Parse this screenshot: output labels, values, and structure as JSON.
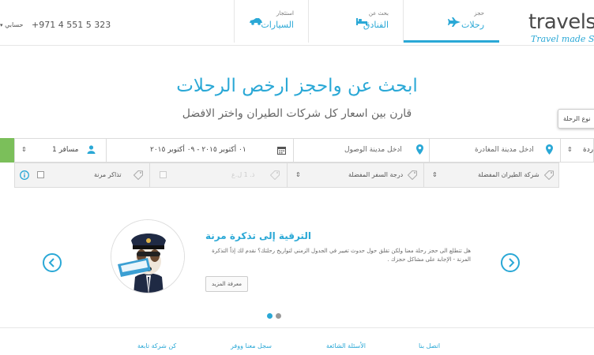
{
  "header": {
    "brand_name": "travelst",
    "brand_tagline": "Travel made S",
    "phone": "+971 4 551 5 323",
    "account_label": "حسابي",
    "tabs": [
      {
        "small": "حجز",
        "label": "رحلات",
        "icon": "airplane-icon",
        "active": true
      },
      {
        "small": "بحث عن",
        "label": "الفنادق",
        "icon": "bed-icon",
        "active": false
      },
      {
        "small": "استئجار",
        "label": "السيارات",
        "icon": "car-icon",
        "active": false
      }
    ]
  },
  "hero": {
    "title": "ابحث عن واحجز ارخص الرحلات",
    "subtitle": "قارن بين اسعار كل شركات الطيران واختر الافضل"
  },
  "tooltip": {
    "text": "نوع الرحلة"
  },
  "search": {
    "trip_type_value": "ردة",
    "departure_placeholder": "ادخل مدينة المغادرة",
    "arrival_placeholder": "ادخل مدينة الوصول",
    "dates_value": "٠١ أكتوبر ٢٠١٥ - ٠٩ أكتوبر ٢٠١٥",
    "passengers_value": "1 مسافر"
  },
  "filters": {
    "airline_label": "شركة الطيران المفضلة",
    "class_label": "درجة السفر المفضلة",
    "disabled_label": "ذ. 1 ل.ع",
    "flexible_label": "تذاكر مرنة"
  },
  "promo": {
    "title": "الترقية إلى تذكرة مرنة",
    "body": "هل تتطلع الى حجز رحلة معنا ولكن تقلق حول حدوث تغيير في الجدول الزمني لتواريخ رحلتك؟ نقدم لك إذاً التذكرة المرنة - الإجابة على مشاكل حجزك .",
    "button_label": "معرفة المزيد",
    "slides": 2,
    "active_slide": 0
  },
  "footer": {
    "links": [
      "اتصل بنا",
      "الأسئلة الشائعة",
      "سجل معنا ووفر",
      "كن شركة تابعة"
    ]
  },
  "colors": {
    "accent": "#2aa8d6",
    "green": "#7bbf5a"
  }
}
